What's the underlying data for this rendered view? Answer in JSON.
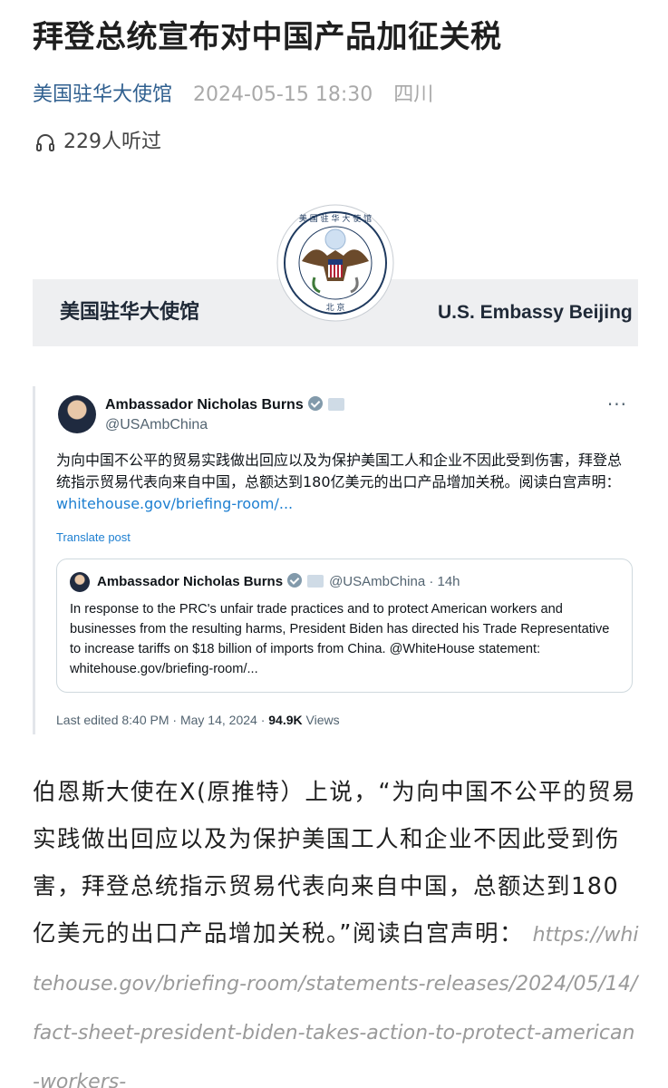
{
  "article": {
    "title": "拜登总统宣布对中国产品加征关税",
    "source": "美国驻华大使馆",
    "time": "2024-05-15 18:30",
    "region": "四川",
    "listen_count": "229人听过"
  },
  "banner": {
    "name_zh": "美国驻华大使馆",
    "name_en": "U.S. Embassy Beijing",
    "seal_top_text": "美 国 驻 华 大 使 馆",
    "seal_bottom_text": "北 京"
  },
  "tweet": {
    "author": "Ambassador Nicholas Burns",
    "handle": "@USAmbChina",
    "more": "···",
    "body": "为向中国不公平的贸易实践做出回应以及为保护美国工人和企业不因此受到伤害，拜登总统指示贸易代表向来自中国，总额达到180亿美元的出口产品增加关税。阅读白宫声明：",
    "link": "whitehouse.gov/briefing-room/...",
    "translate": "Translate post",
    "quote": {
      "author": "Ambassador Nicholas Burns",
      "meta": "@USAmbChina · 14h",
      "body": "In response to the PRC's unfair trade practices and to protect American workers and businesses from the resulting harms, President Biden has directed his Trade Representative to increase tariffs on $18 billion of imports from China. @WhiteHouse statement: whitehouse.gov/briefing-room/..."
    },
    "footer_prefix": "Last edited 8:40 PM · May 14, 2024 · ",
    "views_count": "94.9K",
    "views_label": " Views"
  },
  "paragraph": {
    "text": "伯恩斯大使在X(原推特）上说，“为向中国不公平的贸易实践做出回应以及为保护美国工人和企业不因此受到伤害，拜登总统指示贸易代表向来自中国，总额达到180亿美元的出口产品增加关税。”阅读白宫声明：",
    "url": "https://whitehouse.gov/briefing-room/statements-releases/2024/05/14/fact-sheet-president-biden-takes-action-to-protect-american-workers-"
  },
  "colors": {
    "source": "#2f5f8f",
    "link": "#1d7fd1",
    "muted": "#a9a9a9"
  },
  "icons": [
    "headphones-icon",
    "verified-badge-icon",
    "affiliation-flag-icon",
    "more-options-icon",
    "embassy-seal-icon"
  ]
}
